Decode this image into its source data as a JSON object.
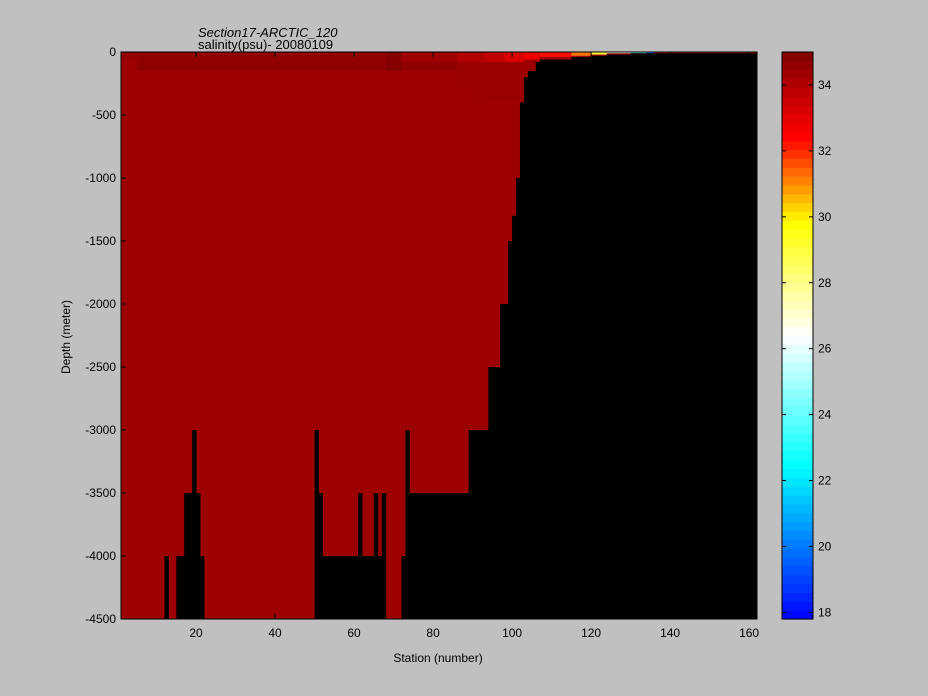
{
  "chart_data": {
    "type": "heatmap",
    "title": "Section17-ARCTIC_120",
    "subtitle": "salinity(psu)- 20080109",
    "xlabel": "Station (number)",
    "ylabel": "Depth (meter)",
    "xlim": [
      1,
      162
    ],
    "ylim": [
      -4500,
      0
    ],
    "x_ticks": [
      20,
      40,
      60,
      80,
      100,
      120,
      140,
      160
    ],
    "y_ticks": [
      0,
      -500,
      -1000,
      -1500,
      -2000,
      -2500,
      -3000,
      -3500,
      -4000,
      -4500
    ],
    "colorbar": {
      "range": [
        17.8,
        35
      ],
      "ticks": [
        18,
        20,
        22,
        24,
        26,
        28,
        30,
        32,
        34
      ],
      "colormap": "jet-white",
      "colors": [
        "#0000ff",
        "#00ffff",
        "#ffffff",
        "#ffff00",
        "#ff0000",
        "#800000"
      ],
      "stops": [
        0,
        0.27,
        0.5,
        0.7,
        0.85,
        1.0
      ]
    },
    "background_value": 34.9,
    "background_color": "#9c0000",
    "land_color": "#000000",
    "land_columns": [
      {
        "x0": 12,
        "x1": 13,
        "bottom": -4000
      },
      {
        "x0": 15,
        "x1": 17,
        "bottom": -4000
      },
      {
        "x0": 17,
        "x1": 19,
        "bottom": -3500
      },
      {
        "x0": 19,
        "x1": 20,
        "bottom": -3000
      },
      {
        "x0": 20,
        "x1": 21,
        "bottom": -3500
      },
      {
        "x0": 21,
        "x1": 22,
        "bottom": -4000
      },
      {
        "x0": 50,
        "x1": 51,
        "bottom": -3000
      },
      {
        "x0": 51,
        "x1": 52,
        "bottom": -3500
      },
      {
        "x0": 52,
        "x1": 61,
        "bottom": -4000
      },
      {
        "x0": 61,
        "x1": 62,
        "bottom": -3500
      },
      {
        "x0": 62,
        "x1": 65,
        "bottom": -4000
      },
      {
        "x0": 65,
        "x1": 66,
        "bottom": -3500
      },
      {
        "x0": 66,
        "x1": 67,
        "bottom": -4000
      },
      {
        "x0": 67,
        "x1": 68,
        "bottom": -3500
      },
      {
        "x0": 68,
        "x1": 72,
        "bottom": -4500
      },
      {
        "x0": 72,
        "x1": 73,
        "bottom": -4000
      },
      {
        "x0": 73,
        "x1": 74,
        "bottom": -3000
      },
      {
        "x0": 74,
        "x1": 89,
        "bottom": -3500
      },
      {
        "x0": 89,
        "x1": 94,
        "bottom": -3000
      },
      {
        "x0": 94,
        "x1": 97,
        "bottom": -2500
      },
      {
        "x0": 97,
        "x1": 99,
        "bottom": -2000
      },
      {
        "x0": 99,
        "x1": 100,
        "bottom": -1500
      },
      {
        "x0": 100,
        "x1": 101,
        "bottom": -1300
      },
      {
        "x0": 101,
        "x1": 102,
        "bottom": -1000
      },
      {
        "x0": 102,
        "x1": 103,
        "bottom": -400
      },
      {
        "x0": 103,
        "x1": 104,
        "bottom": -200
      },
      {
        "x0": 104,
        "x1": 106,
        "bottom": -150
      },
      {
        "x0": 106,
        "x1": 107,
        "bottom": -80
      },
      {
        "x0": 107,
        "x1": 115,
        "bottom": -60
      },
      {
        "x0": 115,
        "x1": 120,
        "bottom": -40
      },
      {
        "x0": 120,
        "x1": 124,
        "bottom": -30
      },
      {
        "x0": 124,
        "x1": 130,
        "bottom": -20
      },
      {
        "x0": 130,
        "x1": 162,
        "bottom": -10
      }
    ],
    "water_patches": [
      {
        "x0": 1,
        "x1": 5,
        "top": 0,
        "bottom": -60,
        "value": 34.6
      },
      {
        "x0": 5,
        "x1": 68,
        "top": 0,
        "bottom": -150,
        "value": 34.7
      },
      {
        "x0": 68,
        "x1": 72,
        "top": 0,
        "bottom": -150,
        "value": 34.9
      },
      {
        "x0": 72,
        "x1": 86,
        "top": 0,
        "bottom": -150,
        "value": 34.7
      },
      {
        "x0": 86,
        "x1": 90,
        "top": -40,
        "bottom": -300,
        "value": 34.5
      },
      {
        "x0": 90,
        "x1": 93,
        "top": -80,
        "bottom": -400,
        "value": 34.5
      },
      {
        "x0": 93,
        "x1": 102,
        "top": -80,
        "bottom": -380,
        "value": 34.5
      },
      {
        "x0": 72,
        "x1": 86,
        "top": 0,
        "bottom": -80,
        "value": 34.4
      },
      {
        "x0": 86,
        "x1": 93,
        "top": 0,
        "bottom": -80,
        "value": 34.0
      },
      {
        "x0": 93,
        "x1": 98,
        "top": 0,
        "bottom": -80,
        "value": 33.7
      },
      {
        "x0": 98,
        "x1": 103,
        "top": 0,
        "bottom": -80,
        "value": 33.2
      },
      {
        "x0": 103,
        "x1": 107,
        "top": 0,
        "bottom": -60,
        "value": 32.8
      },
      {
        "x0": 107,
        "x1": 115,
        "top": 0,
        "bottom": -40,
        "value": 32.3
      },
      {
        "x0": 115,
        "x1": 120,
        "top": 0,
        "bottom": -30,
        "value": 31.2
      },
      {
        "x0": 120,
        "x1": 124,
        "top": 0,
        "bottom": -20,
        "value": 29.0
      },
      {
        "x0": 124,
        "x1": 130,
        "top": 0,
        "bottom": -10,
        "value": 26.5
      },
      {
        "x0": 130,
        "x1": 134,
        "top": 0,
        "bottom": -10,
        "value": 24.0
      },
      {
        "x0": 134,
        "x1": 136,
        "top": 0,
        "bottom": -10,
        "value": 20.0
      }
    ]
  }
}
